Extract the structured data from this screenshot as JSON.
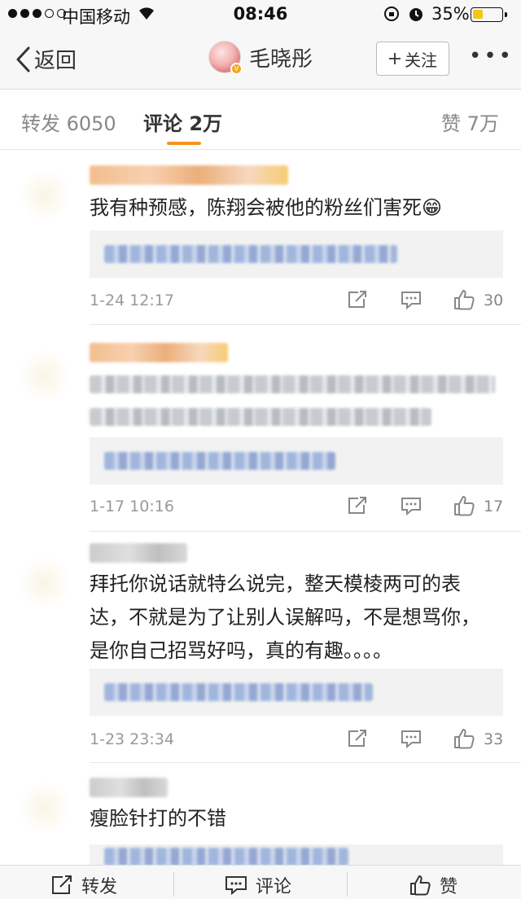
{
  "status_bar": {
    "carrier": "中国移动",
    "time": "08:46",
    "battery_percent": "35%",
    "battery_level": 0.35
  },
  "nav": {
    "back_label": "返回",
    "title": "毛晓彤",
    "follow_label": "关注",
    "follow_icon": "plus-icon",
    "more_label": "•••"
  },
  "tabs": [
    {
      "label": "转发 6050",
      "active": false
    },
    {
      "label": "评论 2万",
      "active": true
    },
    {
      "label": "赞 7万",
      "active": false
    }
  ],
  "comments": [
    {
      "text": "我有种预感，陈翔会被他的粉丝们害死😁",
      "time": "1-24 12:17",
      "likes": "30"
    },
    {
      "text": "",
      "time": "1-17 10:16",
      "likes": "17"
    },
    {
      "text": "拜托你说话就特么说完，整天模棱两可的表达，不就是为了让别人误解吗，不是想骂你，是你自己招骂好吗，真的有趣。。。。",
      "time": "1-23 23:34",
      "likes": "33"
    },
    {
      "text": "瘦脸针打的不错",
      "time": "",
      "likes": ""
    }
  ],
  "toolbar": {
    "repost_label": "转发",
    "comment_label": "评论",
    "like_label": "赞"
  },
  "colors": {
    "accent": "#f7931e",
    "link_blue": "#5877c0",
    "battery_yellow": "#f5c518"
  }
}
